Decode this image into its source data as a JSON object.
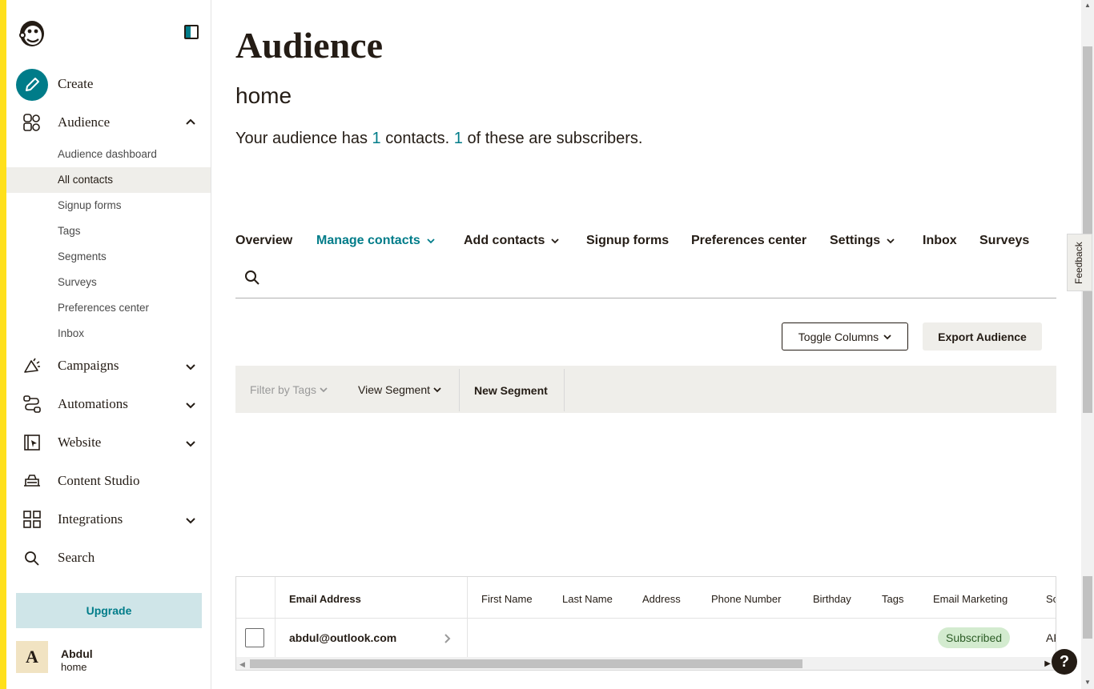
{
  "sidebar": {
    "create_label": "Create",
    "audience_label": "Audience",
    "audience_sub": [
      "Audience dashboard",
      "All contacts",
      "Signup forms",
      "Tags",
      "Segments",
      "Surveys",
      "Preferences center",
      "Inbox"
    ],
    "active_sub": "All contacts",
    "campaigns_label": "Campaigns",
    "automations_label": "Automations",
    "website_label": "Website",
    "content_studio_label": "Content Studio",
    "integrations_label": "Integrations",
    "search_label": "Search",
    "upgrade_label": "Upgrade",
    "user": {
      "initial": "A",
      "name": "Abdul",
      "account": "home"
    }
  },
  "main": {
    "title": "Audience",
    "audience_name": "home",
    "summary": {
      "prefix": "Your audience has ",
      "contacts": "1",
      "middle": " contacts. ",
      "subscribers": "1",
      "suffix": " of these are subscribers."
    },
    "tabs": [
      "Overview",
      "Manage contacts",
      "Add contacts",
      "Signup forms",
      "Preferences center",
      "Settings",
      "Inbox",
      "Surveys"
    ],
    "active_tab": "Manage contacts",
    "toggle_columns": "Toggle Columns",
    "export_audience": "Export Audience",
    "filter_by_tags": "Filter by Tags",
    "view_segment": "View Segment",
    "new_segment": "New Segment",
    "table": {
      "columns": [
        "Email Address",
        "First Name",
        "Last Name",
        "Address",
        "Phone Number",
        "Birthday",
        "Tags",
        "Email Marketing",
        "So"
      ],
      "rows": [
        {
          "email": "abdul@outlook.com",
          "email_marketing": "Subscribed",
          "cut": "AF"
        }
      ]
    }
  },
  "feedback_label": "Feedback",
  "help_label": "?",
  "colors": {
    "accent": "#007c89",
    "brand_yellow": "#ffe01b",
    "subscribed_bg": "#d3ebcf"
  }
}
